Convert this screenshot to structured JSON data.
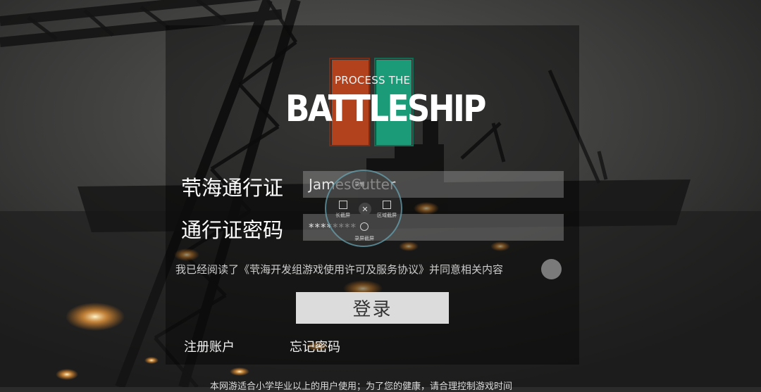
{
  "logo": {
    "subtitle": "PROCESS THE",
    "title": "BATTLESHIP"
  },
  "form": {
    "account_label": "茕海通行证",
    "account_value": "JamesCutter",
    "password_label": "通行证密码",
    "password_value": "********",
    "agreement_text": "我已经阅读了《茕海开发组游戏使用许可及服务协议》并同意相关内容",
    "login_label": "登录"
  },
  "links": {
    "register": "注册账户",
    "forgot": "忘记密码"
  },
  "footer": {
    "notice": "本网游适合小学毕业以上的用户使用；为了您的健康，请合理控制游戏时间"
  },
  "overlay": {
    "top_label": "录制",
    "left_label": "长截屏",
    "right_label": "区域截屏",
    "bottom_label": "录屏截屏"
  },
  "colors": {
    "logo_orange": "#b2421d",
    "logo_green": "#1b9b78",
    "login_button": "#dcdcdc"
  }
}
